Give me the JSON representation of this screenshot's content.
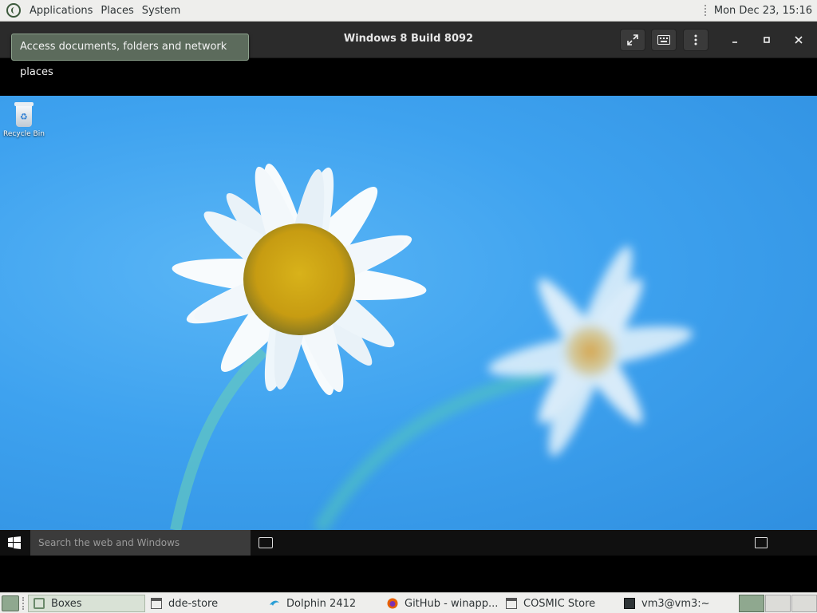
{
  "top_panel": {
    "menus": [
      "Applications",
      "Places",
      "System"
    ],
    "clock": "Mon Dec 23, 15:16"
  },
  "boxes": {
    "title": "Windows 8 Build 8092",
    "tooltip": "Access documents, folders and network places",
    "buttons": [
      "fullscreen-icon",
      "keyboard-icon",
      "menu-icon",
      "minimize-icon",
      "maximize-icon",
      "close-icon"
    ]
  },
  "guest": {
    "desktop_icons": [
      {
        "label": "Recycle Bin",
        "icon": "recycle-bin-icon"
      }
    ],
    "taskbar": {
      "search_placeholder": "Search the web and Windows"
    },
    "wallpaper": "daisy-on-blue-sky"
  },
  "bottom_panel": {
    "tasks": [
      {
        "label": "Boxes",
        "icon": "boxes-icon",
        "active": true
      },
      {
        "label": "dde-store",
        "icon": "window-icon",
        "active": false
      },
      {
        "label": "Dolphin 2412",
        "icon": "dolphin-icon",
        "active": false
      },
      {
        "label": "GitHub - winapp...",
        "icon": "firefox-icon",
        "active": false
      },
      {
        "label": "COSMIC Store",
        "icon": "window-icon",
        "active": false
      },
      {
        "label": "vm3@vm3:~",
        "icon": "terminal-icon",
        "active": false
      }
    ]
  },
  "colors": {
    "panel": "#eeeeec",
    "header": "#2b2b2b",
    "sky": "#3ea2ef",
    "tooltip": "#5c6b5c"
  }
}
